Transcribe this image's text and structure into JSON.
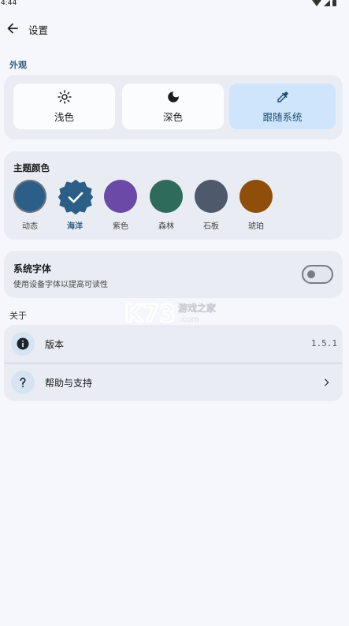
{
  "status_bar": {
    "time": "4:44"
  },
  "app_bar": {
    "title": "设置"
  },
  "appearance": {
    "section_label": "外观",
    "modes": [
      {
        "label": "浅色",
        "icon": "sun-icon",
        "selected": false
      },
      {
        "label": "深色",
        "icon": "moon-icon",
        "selected": false
      },
      {
        "label": "跟随系统",
        "icon": "eyedropper-icon",
        "selected": true
      }
    ]
  },
  "theme": {
    "title": "主题颜色",
    "swatches": [
      {
        "label": "动态",
        "color": "#2b5f87",
        "selected": false
      },
      {
        "label": "海洋",
        "color": "#2b5f87",
        "selected": true
      },
      {
        "label": "紫色",
        "color": "#6a4aa6",
        "selected": false
      },
      {
        "label": "森林",
        "color": "#2f6b5a",
        "selected": false
      },
      {
        "label": "石板",
        "color": "#4e5a6b",
        "selected": false
      },
      {
        "label": "琥珀",
        "color": "#8f4f0b",
        "selected": false
      }
    ]
  },
  "system_font": {
    "title": "系统字体",
    "subtitle": "使用设备字体以提高可读性",
    "enabled": false
  },
  "about": {
    "section_label": "关于",
    "version_label": "版本",
    "version_value": "1.5.1",
    "help_label": "帮助与支持"
  },
  "colors": {
    "accent": "#2f5f85",
    "selected_mode_bg": "#cfe5fb",
    "card_bg": "#e9ecf2",
    "page_bg": "#f6f7fc"
  }
}
